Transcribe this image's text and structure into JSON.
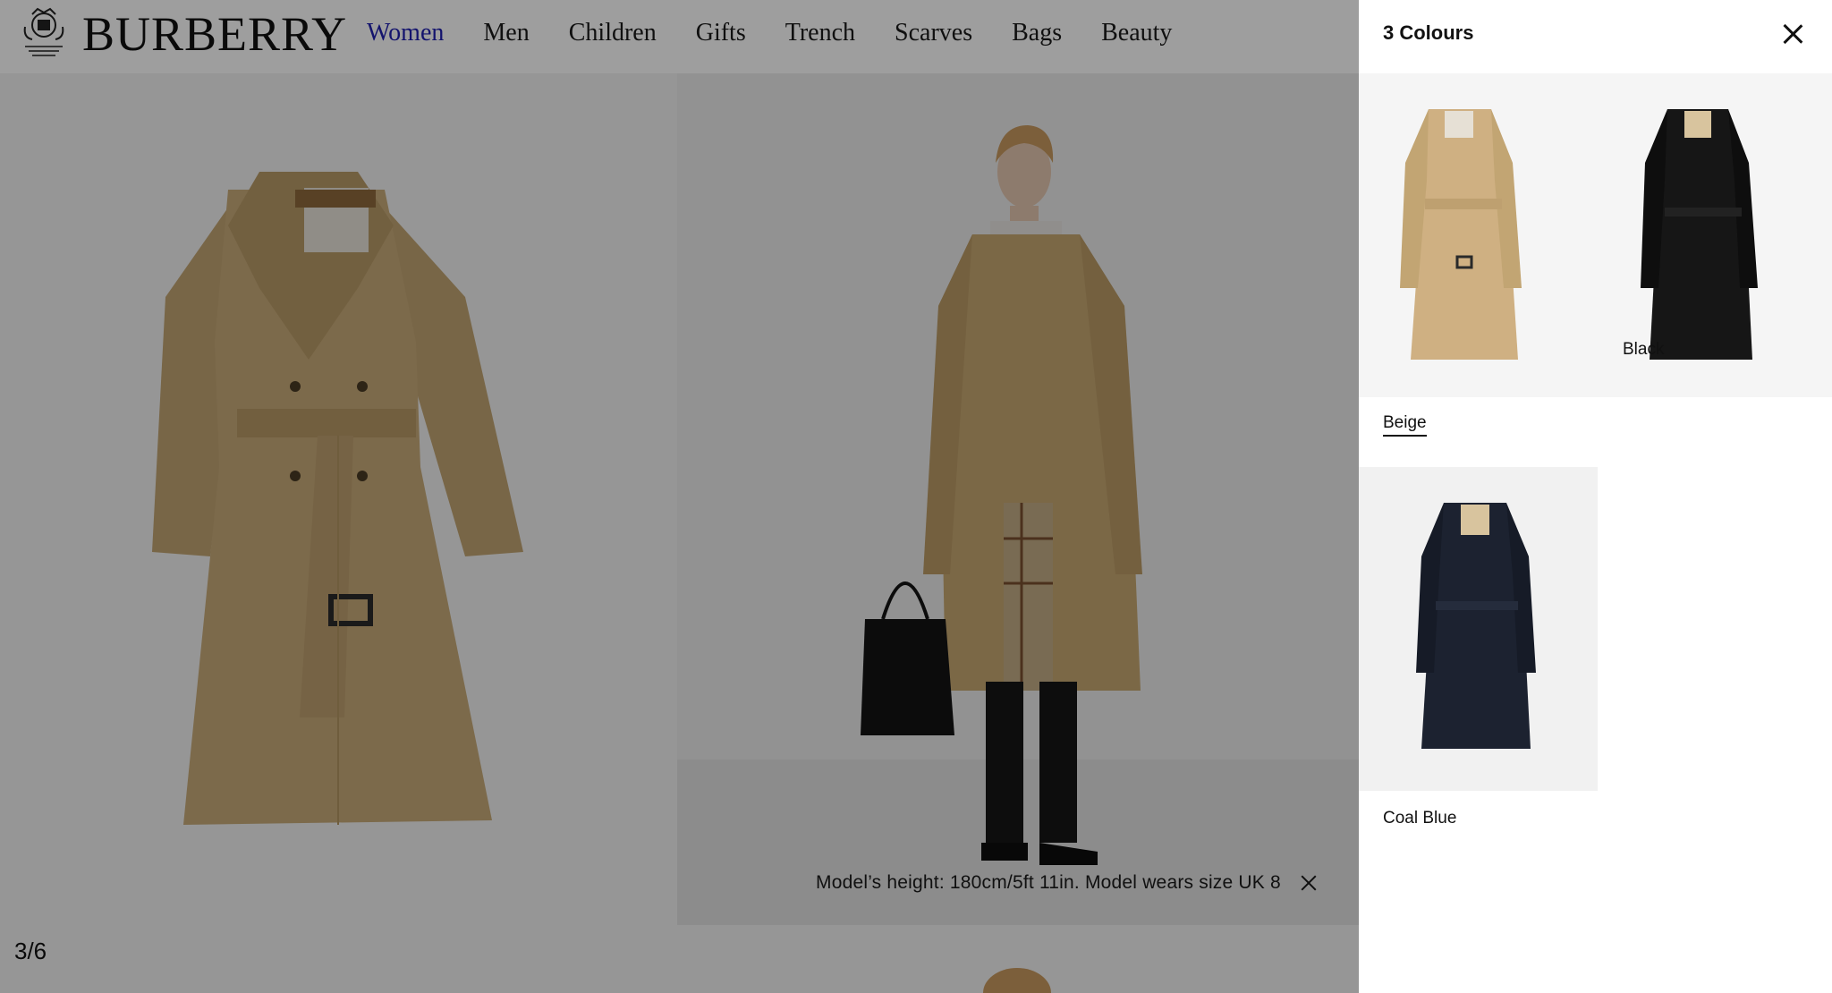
{
  "brand": {
    "wordmark": "BURBERRY",
    "crest_icon": "royal-warrant-crest-icon"
  },
  "nav": {
    "items": [
      {
        "label": "Women",
        "active": true
      },
      {
        "label": "Men",
        "active": false
      },
      {
        "label": "Children",
        "active": false
      },
      {
        "label": "Gifts",
        "active": false
      },
      {
        "label": "Trench",
        "active": false
      },
      {
        "label": "Scarves",
        "active": false
      },
      {
        "label": "Bags",
        "active": false
      },
      {
        "label": "Beauty",
        "active": false
      }
    ]
  },
  "gallery": {
    "model_caption": "Model’s height: 180cm/5ft 11in. Model wears size UK 8",
    "close_icon": "close-icon",
    "counter": "3/6"
  },
  "drawer": {
    "title": "3 Colours",
    "close_icon": "close-icon",
    "swatches": [
      {
        "label": "Beige",
        "selected": true,
        "color": "#c9a97a"
      },
      {
        "label": "Black",
        "selected": false,
        "color": "#121212"
      },
      {
        "label": "Coal Blue",
        "selected": false,
        "color": "#1c2230"
      }
    ]
  },
  "colors": {
    "nav_active": "#1f1fb0",
    "trench_beige": "#c2a573",
    "overlay": "rgba(0,0,0,0.38)"
  }
}
